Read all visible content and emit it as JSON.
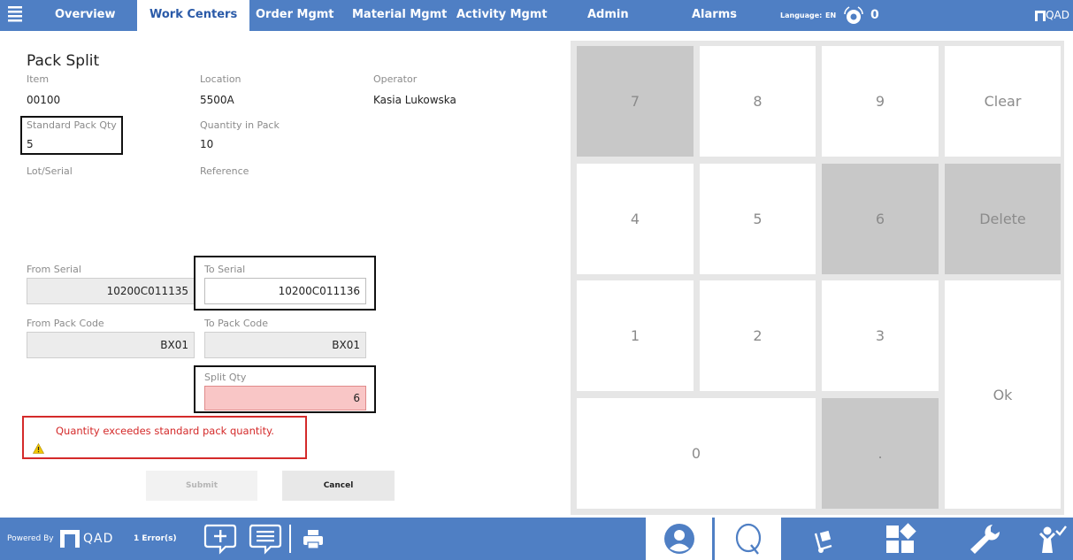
{
  "nav": {
    "tabs": [
      {
        "label": "Overview",
        "active": false
      },
      {
        "label": "Work Centers",
        "active": true
      },
      {
        "label": "Order Mgmt",
        "active": false
      },
      {
        "label": "Material Mgmt",
        "active": false
      },
      {
        "label": "Activity Mgmt",
        "active": false
      },
      {
        "label": "Admin",
        "active": false
      },
      {
        "label": "Alarms",
        "active": false
      }
    ],
    "language_label": "Language:",
    "language_code": "EN",
    "alarm_count": "0",
    "brand": "QAD"
  },
  "form": {
    "title": "Pack Split",
    "item_label": "Item",
    "item_value": "00100",
    "location_label": "Location",
    "location_value": "5500A",
    "operator_label": "Operator",
    "operator_value": "Kasia Lukowska",
    "std_pack_qty_label": "Standard Pack Qty",
    "std_pack_qty_value": "5",
    "qty_in_pack_label": "Quantity in Pack",
    "qty_in_pack_value": "10",
    "lot_serial_label": "Lot/Serial",
    "reference_label": "Reference",
    "from_serial_label": "From Serial",
    "from_serial_value": "10200C011135",
    "to_serial_label": "To Serial",
    "to_serial_value": "10200C011136",
    "from_pack_code_label": "From Pack Code",
    "from_pack_code_value": "BX01",
    "to_pack_code_label": "To Pack Code",
    "to_pack_code_value": "BX01",
    "split_qty_label": "Split Qty",
    "split_qty_value": "6",
    "error_message": "Quantity exceedes standard pack quantity.",
    "submit_label": "Submit",
    "cancel_label": "Cancel"
  },
  "keypad": {
    "k7": "7",
    "k8": "8",
    "k9": "9",
    "clear": "Clear",
    "k4": "4",
    "k5": "5",
    "k6": "6",
    "delete": "Delete",
    "k1": "1",
    "k2": "2",
    "k3": "3",
    "ok": "Ok",
    "k0": "0",
    "dot": "."
  },
  "footer": {
    "powered_by": "Powered By",
    "brand": "QAD",
    "errors": "1 Error(s)"
  },
  "colors": {
    "accent": "#4f7fc4",
    "error": "#d42a2a",
    "error_field": "#f9c6c6"
  }
}
